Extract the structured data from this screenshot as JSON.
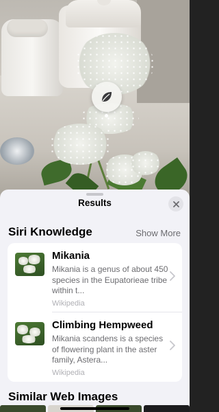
{
  "sheet": {
    "title": "Results",
    "close_icon": "xmark-icon"
  },
  "lookup_badge": {
    "icon": "leaf-icon"
  },
  "siri_knowledge": {
    "title": "Siri Knowledge",
    "show_more": "Show More",
    "items": [
      {
        "title": "Mikania",
        "description": "Mikania is a genus of about 450 species in the Eupatorieae tribe within t...",
        "source": "Wikipedia"
      },
      {
        "title": "Climbing Hempweed",
        "description": "Mikania scandens is a species of flowering plant in the aster family, Astera...",
        "source": "Wikipedia"
      }
    ]
  },
  "similar_web_images": {
    "title": "Similar Web Images"
  }
}
